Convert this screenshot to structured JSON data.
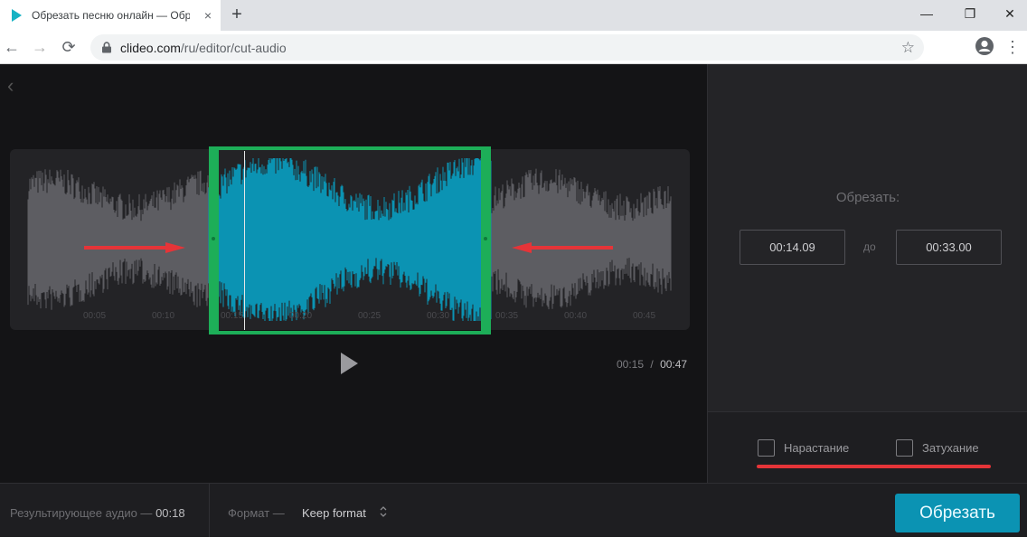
{
  "browser": {
    "tab_title": "Обрезать песню онлайн — Обрезать",
    "tab_close": "×",
    "new_tab": "+",
    "url_host": "clideo.com",
    "url_path": "/ru/editor/cut-audio",
    "window_minimize": "—",
    "window_restore": "❐",
    "window_close": "✕"
  },
  "editor": {
    "timeline_ticks": [
      "00:05",
      "00:10",
      "00:15",
      "00:20",
      "00:25",
      "00:30",
      "00:35",
      "00:40",
      "00:45"
    ],
    "current_time": "00:15",
    "time_separator": "/",
    "total_time": "00:47",
    "selection_color": "#1dae58",
    "wave_selected_color": "#0b93b3",
    "wave_unselected_color": "#5d5d62",
    "arrow_color": "#e53438"
  },
  "panel": {
    "title": "Обрезать:",
    "start_time": "00:14.09",
    "to_label": "до",
    "end_time": "00:33.00",
    "fade_in_label": "Нарастание",
    "fade_out_label": "Затухание",
    "fade_in_checked": false,
    "fade_out_checked": false
  },
  "bottom": {
    "result_label": "Результирующее аудио —",
    "result_duration": "00:18",
    "format_label": "Формат —",
    "format_value": "Keep format",
    "cut_button": "Обрезать"
  }
}
